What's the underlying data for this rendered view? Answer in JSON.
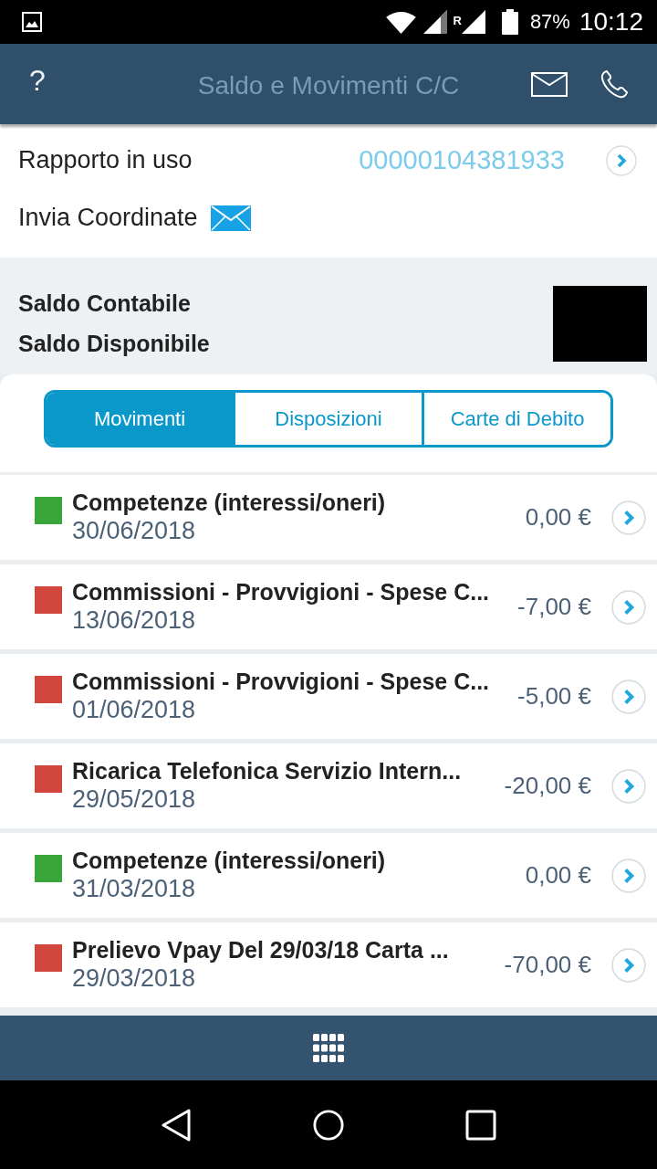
{
  "status_bar": {
    "roaming": "R",
    "battery": "87%",
    "time": "10:12"
  },
  "app_bar": {
    "help": "?",
    "title": "Saldo e Movimenti C/C"
  },
  "account": {
    "label": "Rapporto in uso",
    "number": "00000104381933",
    "send_label": "Invia Coordinate"
  },
  "balances": [
    {
      "label": "Saldo Contabile"
    },
    {
      "label": "Saldo Disponibile"
    }
  ],
  "tabs": [
    {
      "label": "Movimenti",
      "selected": true
    },
    {
      "label": "Disposizioni",
      "selected": false
    },
    {
      "label": "Carte di Debito",
      "selected": false
    }
  ],
  "transactions": [
    {
      "description": "Competenze (interessi/oneri)",
      "date": "30/06/2018",
      "amount": "0,00 €",
      "color": "#3aa53a"
    },
    {
      "description": "Commissioni - Provvigioni - Spese C...",
      "date": "13/06/2018",
      "amount": "-7,00 €",
      "color": "#d2473d"
    },
    {
      "description": "Commissioni - Provvigioni - Spese C...",
      "date": "01/06/2018",
      "amount": "-5,00 €",
      "color": "#d2473d"
    },
    {
      "description": "Ricarica Telefonica Servizio Intern...",
      "date": "29/05/2018",
      "amount": "-20,00 €",
      "color": "#d2473d"
    },
    {
      "description": "Competenze (interessi/oneri)",
      "date": "31/03/2018",
      "amount": "0,00 €",
      "color": "#3aa53a"
    },
    {
      "description": "Prelievo Vpay Del 29/03/18 Carta ...",
      "date": "29/03/2018",
      "amount": "-70,00 €",
      "color": "#d2473d"
    }
  ]
}
